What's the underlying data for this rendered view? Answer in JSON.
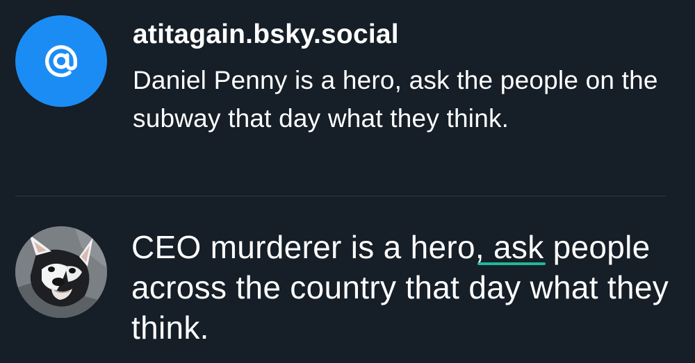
{
  "thread_post": {
    "handle": "atitagain.bsky.social",
    "text": "Daniel Penny is a hero, ask the people on the subway that day what they think.",
    "avatar_icon": "at-sign-icon",
    "avatar_color": "#1c8cf5"
  },
  "composer": {
    "text_before": "CEO murderer is a hero",
    "text_flagged": ", ask",
    "text_after": " people across the country that day what they think.",
    "flag_underline_color": "#1fb89a",
    "avatar_icon": "husky-dog-avatar"
  },
  "theme": {
    "background": "#161e27",
    "divider": "#2f3944",
    "text": "#ffffff"
  }
}
